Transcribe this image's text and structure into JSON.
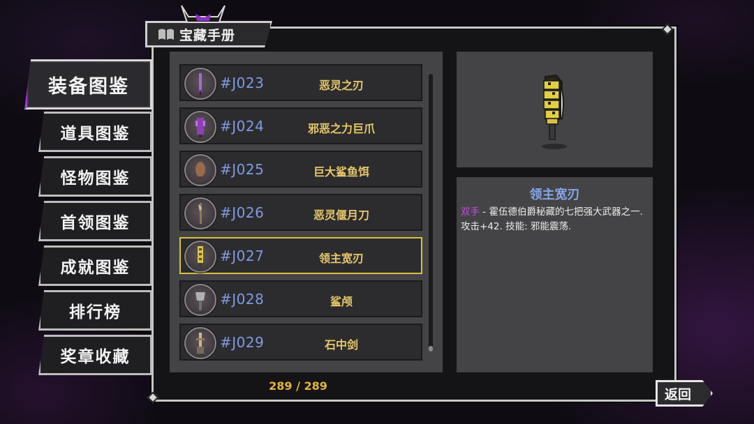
{
  "header": {
    "title": "宝藏手册",
    "book_icon": "open-book-icon",
    "emblem_icon": "demon-horns-icon"
  },
  "sidebar": {
    "items": [
      {
        "label": "装备图鉴",
        "active": true
      },
      {
        "label": "道具图鉴",
        "active": false
      },
      {
        "label": "怪物图鉴",
        "active": false
      },
      {
        "label": "首领图鉴",
        "active": false
      },
      {
        "label": "成就图鉴",
        "active": false
      },
      {
        "label": "排行榜",
        "active": false
      },
      {
        "label": "奖章收藏",
        "active": false
      }
    ]
  },
  "list": {
    "items": [
      {
        "code": "#J023",
        "name": "恶灵之刃",
        "icon": "purple-blade-icon",
        "color": "#9a5cc8"
      },
      {
        "code": "#J024",
        "name": "邪恶之力巨爪",
        "icon": "purple-claw-icon",
        "color": "#8e3fb8"
      },
      {
        "code": "#J025",
        "name": "巨大鲨鱼饵",
        "icon": "shark-bait-icon",
        "color": "#9a6a4a"
      },
      {
        "code": "#J026",
        "name": "恶灵偃月刀",
        "icon": "crescent-blade-icon",
        "color": "#b0a070"
      },
      {
        "code": "#J027",
        "name": "领主宽刃",
        "icon": "broad-blade-icon",
        "color": "#d8c24a",
        "selected": true
      },
      {
        "code": "#J028",
        "name": "鲨颅",
        "icon": "shark-skull-icon",
        "color": "#a0a0a0"
      },
      {
        "code": "#J029",
        "name": "石中剑",
        "icon": "stone-sword-icon",
        "color": "#b89a70"
      }
    ],
    "counter": "289 / 289"
  },
  "detail": {
    "title": "领主宽刃",
    "tag": "双手",
    "text": " - 霍伍德伯爵秘藏的七把强大武器之一.",
    "stats": "攻击+42. 技能: 邪能震荡."
  },
  "back_button": {
    "label": "返回"
  },
  "colors": {
    "accent_purple": "#9b3fd0",
    "gold": "#e5b53c",
    "code_blue": "#7f9be2",
    "selected_border": "#d9c23c"
  }
}
